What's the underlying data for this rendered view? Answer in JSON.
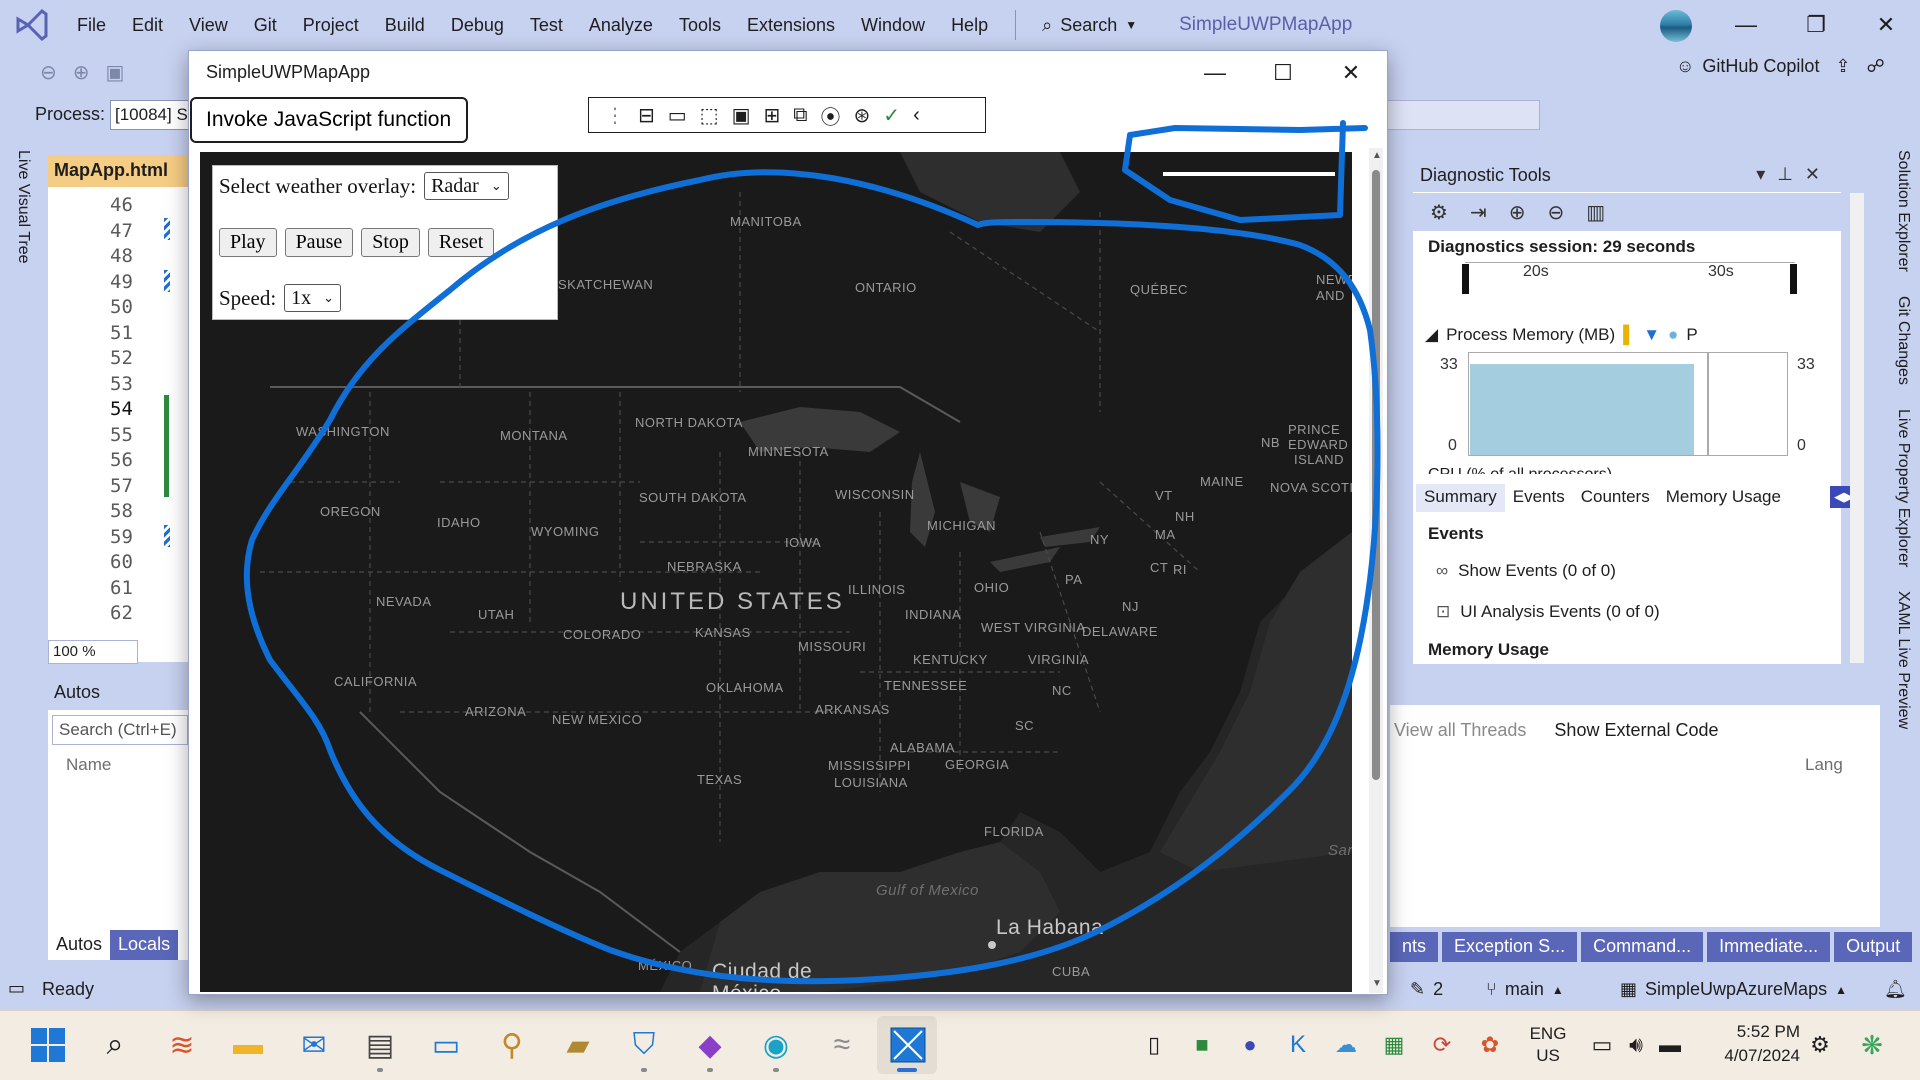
{
  "ide": {
    "menu": [
      "File",
      "Edit",
      "View",
      "Git",
      "Project",
      "Build",
      "Debug",
      "Test",
      "Analyze",
      "Tools",
      "Extensions",
      "Window",
      "Help"
    ],
    "search_label": "Search",
    "solution_title": "SimpleUWPMapApp",
    "process_label": "Process:",
    "process_value": "[10084] S",
    "copilot_label": "GitHub Copilot",
    "left_side_tab": "Live Visual Tree",
    "editor_tab": "MapApp.html",
    "line_numbers": [
      "46",
      "47",
      "48",
      "49",
      "50",
      "51",
      "52",
      "53",
      "54",
      "55",
      "56",
      "57",
      "58",
      "59",
      "60",
      "61",
      "62"
    ],
    "zoom": "100 %",
    "autos_title": "Autos",
    "autos_search": "Search (Ctrl+E)",
    "autos_column": "Name",
    "autos_tabs": [
      "Autos",
      "Locals"
    ],
    "right_bottom_tools": [
      "View all Threads",
      "Show External Code"
    ],
    "right_bottom_column": "Lang",
    "bottom_tabs": [
      "nts",
      "Exception S...",
      "Command...",
      "Immediate...",
      "Output"
    ],
    "right_vtabs": [
      "Solution Explorer",
      "Git Changes",
      "Live Property Explorer",
      "XAML Live Preview"
    ],
    "status": {
      "ready": "Ready",
      "changes": "2",
      "branch": "main",
      "repo": "SimpleUwpAzureMaps"
    }
  },
  "diagnostics": {
    "title": "Diagnostic Tools",
    "session": "Diagnostics session: 29 seconds",
    "timeline_labels": [
      "20s",
      "30s"
    ],
    "process_memory_label": "Process Memory (MB)",
    "legend_tail": "P",
    "y_max": "33",
    "y_min": "0",
    "cpu_label": "CPU (% of all processors)",
    "tabs": [
      "Summary",
      "Events",
      "Counters",
      "Memory Usage"
    ],
    "events_header": "Events",
    "events": [
      "Show Events (0 of 0)",
      "UI Analysis Events (0 of 0)"
    ],
    "memory_header": "Memory Usage"
  },
  "app": {
    "title": "SimpleUWPMapApp",
    "invoke_button": "Invoke JavaScript function",
    "weather_label": "Select weather overlay:",
    "weather_value": "Radar",
    "buttons": [
      "Play",
      "Pause",
      "Stop",
      "Reset"
    ],
    "speed_label": "Speed:",
    "speed_value": "1x"
  },
  "map_labels": {
    "country": "UNITED STATES",
    "provinces": [
      "MANITOBA",
      "ONTARIO",
      "QUÉBEC",
      "SKATCHEWAN",
      "NEWF",
      "AND",
      "PRINCE",
      "EDWARD",
      "ISLAND",
      "NB",
      "NOVA SCOTI",
      "MAINE"
    ],
    "states": [
      "WASHINGTON",
      "MONTANA",
      "NORTH DAKOTA",
      "MINNESOTA",
      "OREGON",
      "IDAHO",
      "WYOMING",
      "SOUTH DAKOTA",
      "WISCONSIN",
      "MICHIGAN",
      "NY",
      "VT",
      "NH",
      "MA",
      "CT",
      "RI",
      "NEBRASKA",
      "IOWA",
      "NEVADA",
      "UTAH",
      "ILLINOIS",
      "INDIANA",
      "OHIO",
      "PA",
      "NJ",
      "COLORADO",
      "KANSAS",
      "MISSOURI",
      "WEST VIRGINIA",
      "DELAWARE",
      "KENTUCKY",
      "VIRGINIA",
      "CALIFORNIA",
      "TENNESSEE",
      "NC",
      "ARIZONA",
      "NEW MEXICO",
      "OKLAHOMA",
      "ARKANSAS",
      "SC",
      "ALABAMA",
      "GEORGIA",
      "TEXAS",
      "MISSISSIPPI",
      "LOUISIANA",
      "FLORIDA"
    ],
    "water": "Gulf of Mexico",
    "cities": [
      "La Habana",
      "Ciudad de",
      "México"
    ],
    "other": [
      "MÉXICO",
      "CUBA",
      "Sar"
    ]
  },
  "taskbar": {
    "lang_top": "ENG",
    "lang_bottom": "US",
    "time": "5:52 PM",
    "date": "4/07/2024"
  },
  "colors": {
    "ide_chrome": "#c7d1f0",
    "annotation": "#0f6fd6",
    "map_bg": "#262626",
    "editor_tab": "#f5cc84",
    "memory_fill": "#a5cde0"
  }
}
